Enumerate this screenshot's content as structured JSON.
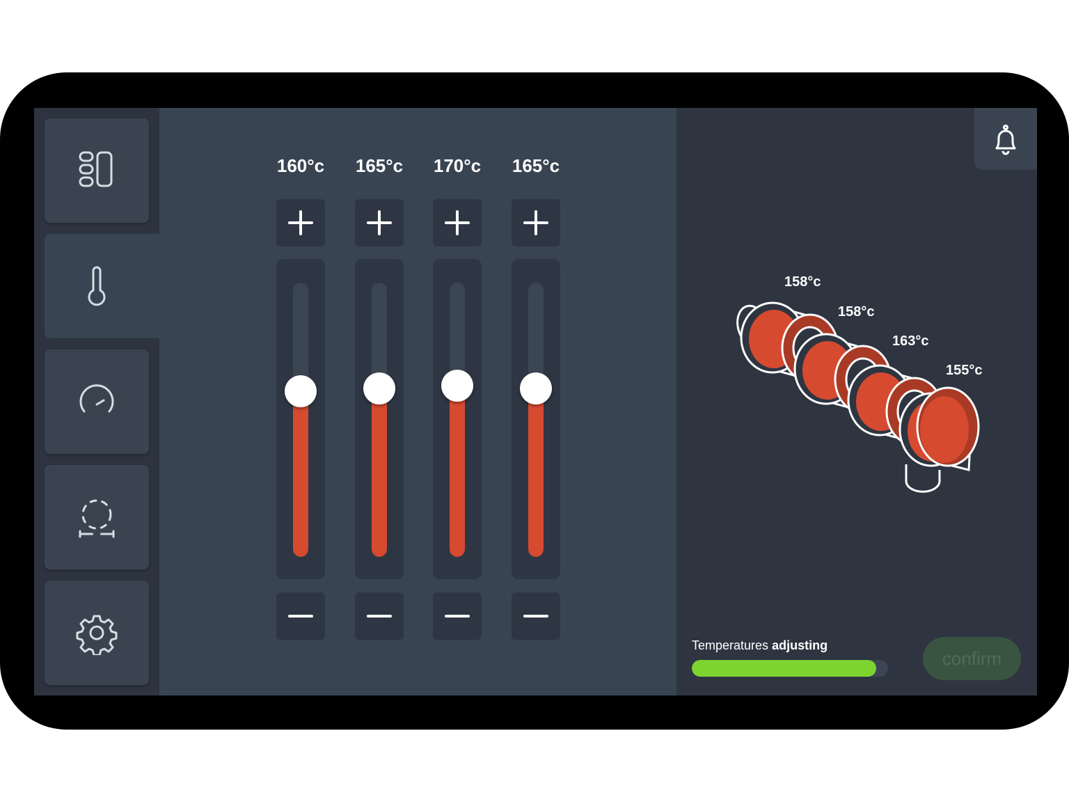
{
  "nav": {
    "items": [
      {
        "name": "dashboard",
        "icon": "layout-panels-icon",
        "active": false
      },
      {
        "name": "temperature",
        "icon": "thermometer-icon",
        "active": true
      },
      {
        "name": "speed",
        "icon": "gauge-icon",
        "active": false
      },
      {
        "name": "measure",
        "icon": "dimensions-icon",
        "active": false
      },
      {
        "name": "settings",
        "icon": "gear-icon",
        "active": false
      }
    ]
  },
  "zones": [
    {
      "setpoint": "160°c",
      "level": 0.605
    },
    {
      "setpoint": "165°c",
      "level": 0.615
    },
    {
      "setpoint": "170°c",
      "level": 0.625
    },
    {
      "setpoint": "165°c",
      "level": 0.615
    }
  ],
  "heater": {
    "readings": [
      "158°c",
      "158°c",
      "163°c",
      "155°c"
    ]
  },
  "status": {
    "prefix": "Temperatures ",
    "state": "adjusting",
    "progress": 0.94
  },
  "confirm_label": "confirm",
  "notifications": {
    "icon": "bell-icon"
  },
  "colors": {
    "heat": "#d64a30",
    "progress": "#7ed42f",
    "panel": "#394452",
    "sidebar": "#2d3440"
  }
}
